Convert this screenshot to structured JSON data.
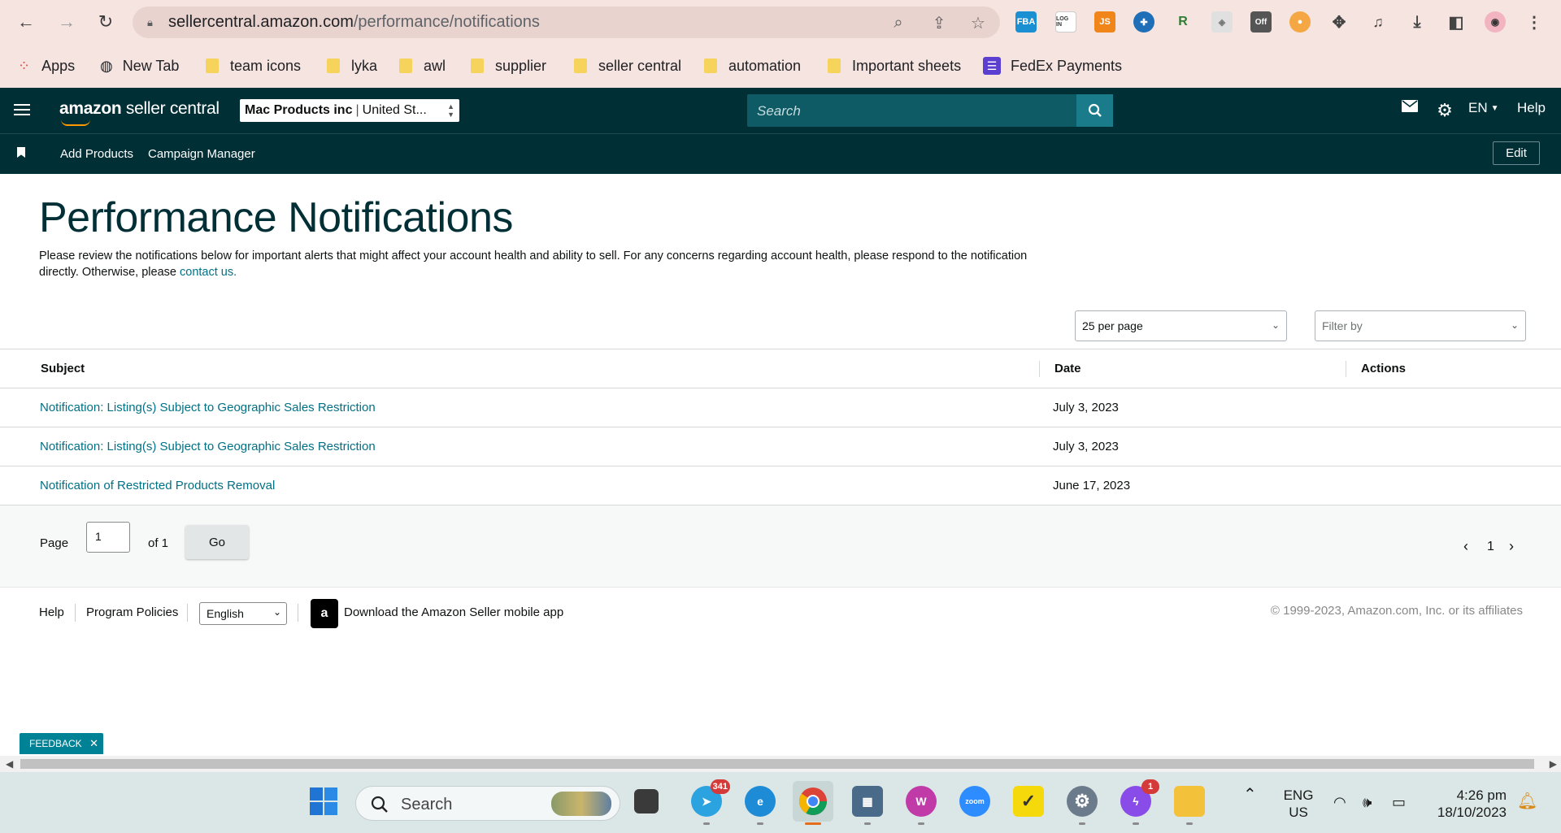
{
  "browser": {
    "url_host": "sellercentral.amazon.com",
    "url_path": "/performance/notifications",
    "bookmarks": [
      "Apps",
      "New Tab",
      "team icons",
      "lyka",
      "awl",
      "supplier",
      "seller central",
      "automation",
      "Important sheets",
      "FedEx Payments"
    ],
    "extensions": [
      "FBA",
      "LOG IN",
      "JS",
      "Off"
    ]
  },
  "header": {
    "logo_bold": "amazon",
    "logo_rest": " seller central",
    "account_name": "Mac Products inc",
    "account_region": "United St...",
    "search_placeholder": "Search",
    "language": "EN",
    "help": "Help",
    "edit": "Edit",
    "shortcuts": [
      "Add Products",
      "Campaign Manager"
    ]
  },
  "page": {
    "title": "Performance Notifications",
    "description": "Please review the notifications below for important alerts that might affect your account health and ability to sell. For any concerns regarding account health, please respond to the notification directly. Otherwise, please ",
    "contact_link": "contact us.",
    "per_page": "25 per page",
    "filter_placeholder": "Filter by"
  },
  "table": {
    "columns": [
      "Subject",
      "Date",
      "Actions"
    ],
    "rows": [
      {
        "subject": "Notification: Listing(s) Subject to Geographic Sales Restriction",
        "date": "July 3, 2023"
      },
      {
        "subject": "Notification: Listing(s) Subject to Geographic Sales Restriction",
        "date": "July 3, 2023"
      },
      {
        "subject": "Notification of Restricted Products Removal",
        "date": "June 17, 2023"
      }
    ]
  },
  "pager": {
    "page_label": "Page",
    "page_value": "1",
    "of_label": "of 1",
    "go": "Go",
    "current": "1"
  },
  "footer": {
    "help": "Help",
    "policies": "Program Policies",
    "language": "English",
    "app_link": "Download the Amazon Seller mobile app",
    "copyright": "© 1999-2023, Amazon.com, Inc. or its affiliates"
  },
  "feedback": "FEEDBACK",
  "taskbar": {
    "search_placeholder": "Search",
    "telegram_badge": "341",
    "messenger_badge": "1",
    "lang_top": "ENG",
    "lang_bottom": "US",
    "time": "4:26 pm",
    "date": "18/10/2023"
  },
  "colors": {
    "header_bg": "#002f36",
    "link": "#007185",
    "accent": "#008296"
  }
}
